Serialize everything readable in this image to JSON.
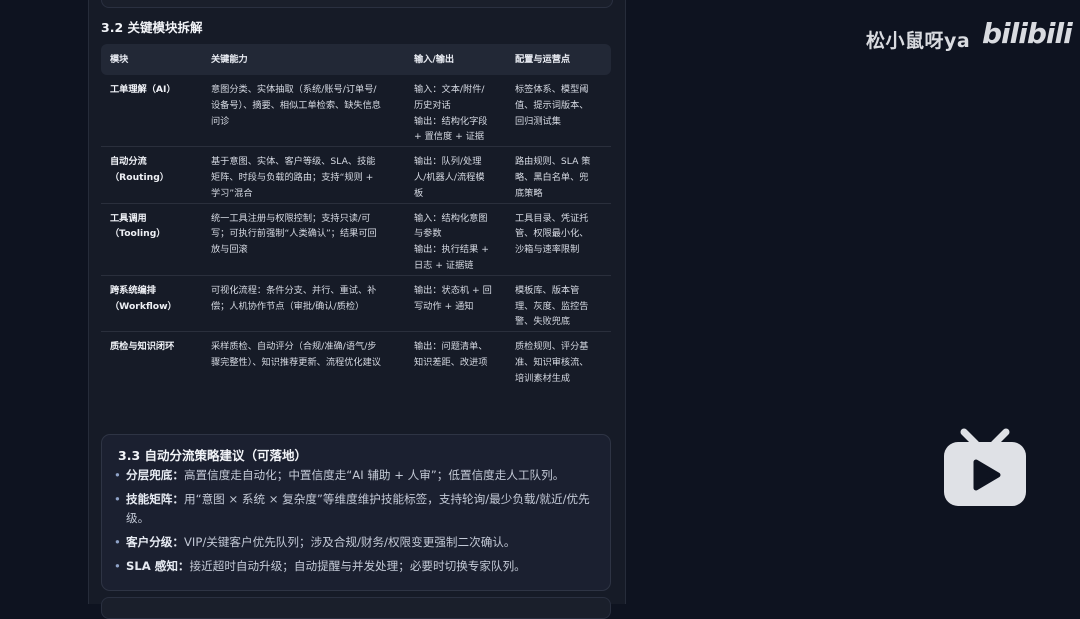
{
  "section_title": "3.2 关键模块拆解",
  "table": {
    "headers": [
      "模块",
      "关键能力",
      "输入/输出",
      "配置与运营点"
    ],
    "rows": [
      {
        "module": [
          "工单理解（AI）"
        ],
        "capability": [
          "意图分类、实体抽取（系统/账号/订单号/",
          "设备号）、摘要、相似工单检索、缺失信息",
          "问诊"
        ],
        "io": [
          "输入：文本/附件/",
          "历史对话",
          "输出：结构化字段",
          "+ 置信度 + 证据"
        ],
        "config": [
          "标签体系、模型阈",
          "值、提示词版本、",
          "回归测试集"
        ]
      },
      {
        "module": [
          "自动分流",
          "（Routing）"
        ],
        "capability": [
          "基于意图、实体、客户等级、SLA、技能",
          "矩阵、时段与负载的路由；支持“规则 +",
          "学习”混合"
        ],
        "io": [
          "输出：队列/处理",
          "人/机器人/流程模",
          "板"
        ],
        "config": [
          "路由规则、SLA 策",
          "略、黑白名单、兜",
          "底策略"
        ]
      },
      {
        "module": [
          "工具调用",
          "（Tooling）"
        ],
        "capability": [
          "统一工具注册与权限控制；支持只读/可",
          "写；可执行前强制“人类确认”；结果可回",
          "放与回滚"
        ],
        "io": [
          "输入：结构化意图",
          "与参数",
          "输出：执行结果 +",
          "日志 + 证据链"
        ],
        "config": [
          "工具目录、凭证托",
          "管、权限最小化、",
          "沙箱与速率限制"
        ]
      },
      {
        "module": [
          "跨系统编排",
          "（Workflow）"
        ],
        "capability": [
          "可视化流程：条件分支、并行、重试、补",
          "偿；人机协作节点（审批/确认/质检）"
        ],
        "io": [
          "输出：状态机 + 回",
          "写动作 + 通知"
        ],
        "config": [
          "模板库、版本管",
          "理、灰度、监控告",
          "警、失败兜底"
        ]
      },
      {
        "module": [
          "质检与知识闭环"
        ],
        "capability": [
          "采样质检、自动评分（合规/准确/语气/步",
          "骤完整性）、知识推荐更新、流程优化建议"
        ],
        "io": [
          "输出：问题清单、",
          "知识差距、改进项"
        ],
        "config": [
          "质检规则、评分基",
          "准、知识审核流、",
          "培训素材生成"
        ]
      }
    ]
  },
  "strategy_card": {
    "title": "3.3 自动分流策略建议（可落地）",
    "items": [
      {
        "term": "分层兜底：",
        "text": "高置信度走自动化；中置信度走“AI 辅助 + 人审”；低置信度走人工队列。"
      },
      {
        "term": "技能矩阵：",
        "text": "用“意图 × 系统 × 复杂度”等维度维护技能标签，支持轮询/最少负载/就近/优先级。"
      },
      {
        "term": "客户分级：",
        "text": "VIP/关键客户优先队列；涉及合规/财务/权限变更强制二次确认。"
      },
      {
        "term": "SLA 感知：",
        "text": "接近超时自动升级；自动提醒与并发处理；必要时切换专家队列。"
      }
    ]
  },
  "watermark": {
    "uploader": "松小鼠呀ya",
    "logo_text": "bilibili"
  },
  "icons": {
    "bullet": "•",
    "tv": "bilibili-tv-play-icon"
  }
}
